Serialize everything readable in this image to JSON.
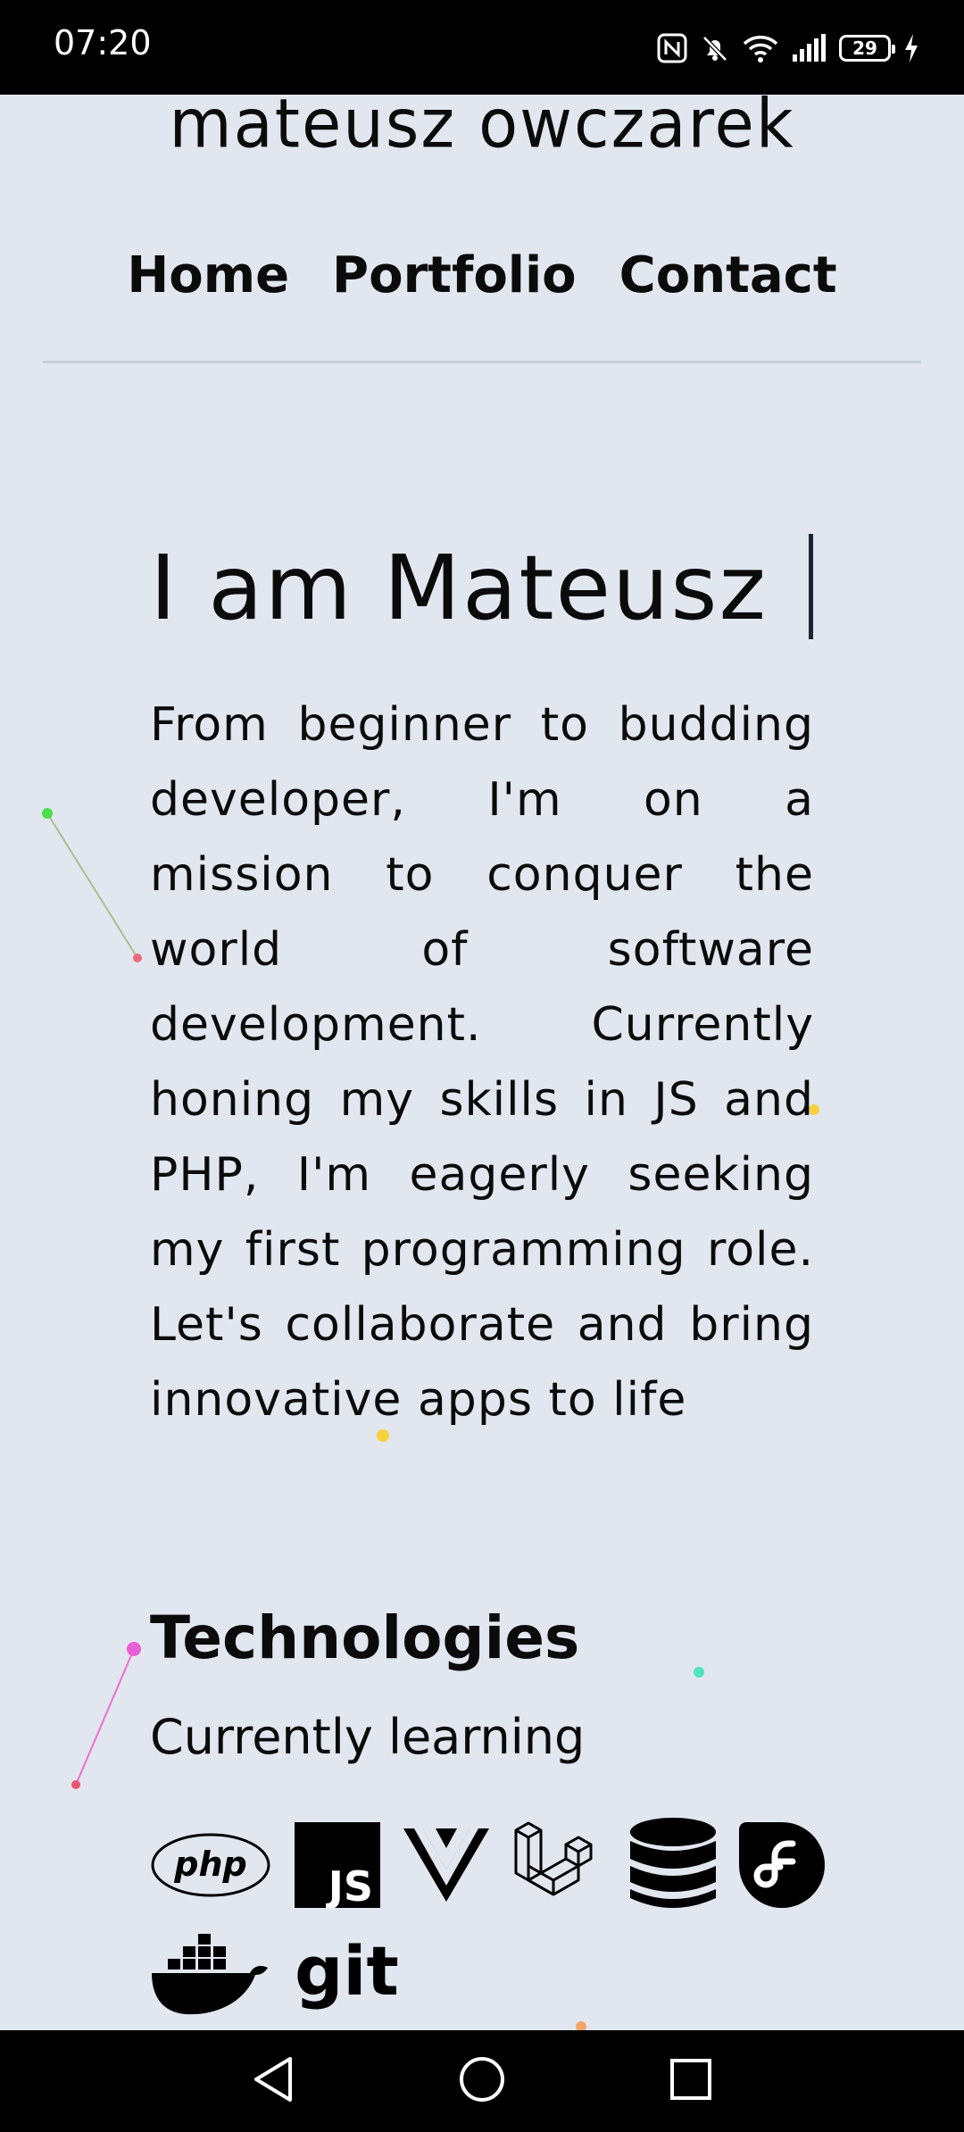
{
  "status_bar": {
    "time": "07:20",
    "battery": "29",
    "icons": [
      "nfc-icon",
      "bell-off-icon",
      "wifi-icon",
      "signal-icon",
      "battery-icon",
      "charging-icon"
    ]
  },
  "site": {
    "title": "mateusz owczarek"
  },
  "nav": {
    "items": [
      {
        "label": "Home"
      },
      {
        "label": "Portfolio"
      },
      {
        "label": "Contact"
      }
    ]
  },
  "hero": {
    "title": "I am Mateusz",
    "intro": "From beginner to budding developer, I'm on a mission to conquer the world of software development. Currently honing my skills in JS and PHP, I'm eagerly seeking my first programming role. Let's collaborate and bring innovative apps to life"
  },
  "technologies": {
    "heading": "Technologies",
    "subheading": "Currently learning",
    "icons": [
      {
        "name": "php-icon",
        "label": "php"
      },
      {
        "name": "javascript-icon",
        "label": "JS"
      },
      {
        "name": "vue-icon"
      },
      {
        "name": "laravel-icon"
      },
      {
        "name": "database-icon"
      },
      {
        "name": "fedora-icon"
      },
      {
        "name": "docker-icon"
      },
      {
        "name": "git-icon",
        "label": "git"
      }
    ]
  },
  "system_nav": {
    "icons": [
      "back-icon",
      "home-icon",
      "recents-icon"
    ]
  }
}
